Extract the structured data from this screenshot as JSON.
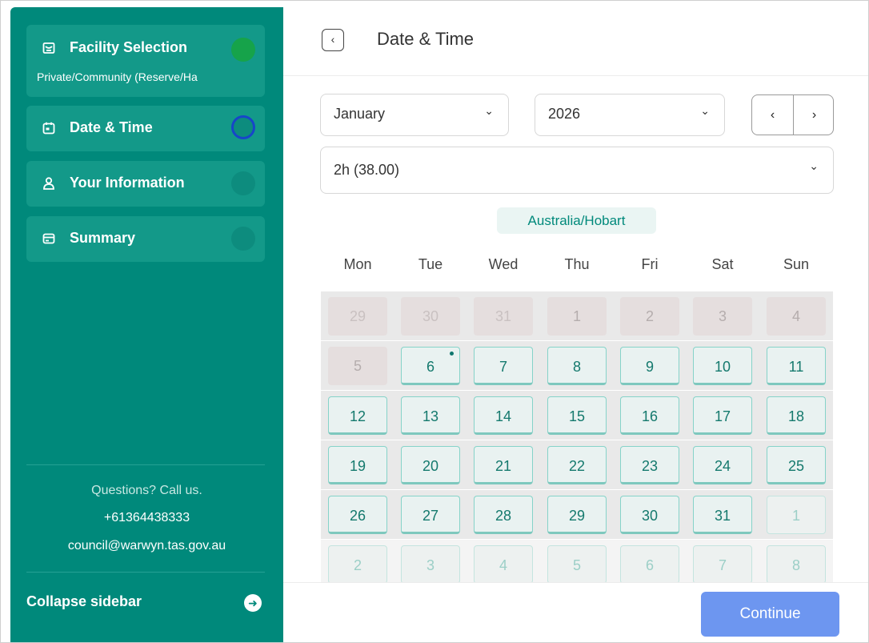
{
  "sidebar": {
    "steps": [
      {
        "label": "Facility Selection",
        "sub": "Private/Community (Reserve/Ha",
        "icon": "storefront-icon",
        "status": "complete"
      },
      {
        "label": "Date & Time",
        "icon": "calendar-icon",
        "status": "current"
      },
      {
        "label": "Your Information",
        "icon": "user-icon",
        "status": "pending"
      },
      {
        "label": "Summary",
        "icon": "card-icon",
        "status": "pending"
      }
    ],
    "contact": {
      "question": "Questions? Call us.",
      "phone": "+61364438333",
      "email": "council@warwyn.tas.gov.au"
    },
    "collapse_label": "Collapse sidebar"
  },
  "header": {
    "title": "Date & Time"
  },
  "filters": {
    "month": "January",
    "year": "2026",
    "duration": "2h (38.00)"
  },
  "timezone": "Australia/Hobart",
  "calendar": {
    "weekdays": [
      "Mon",
      "Tue",
      "Wed",
      "Thu",
      "Fri",
      "Sat",
      "Sun"
    ],
    "weeks": [
      [
        "29",
        "30",
        "31",
        "1",
        "2",
        "3",
        "4"
      ],
      [
        "5",
        "6",
        "7",
        "8",
        "9",
        "10",
        "11"
      ],
      [
        "12",
        "13",
        "14",
        "15",
        "16",
        "17",
        "18"
      ],
      [
        "19",
        "20",
        "21",
        "22",
        "23",
        "24",
        "25"
      ],
      [
        "26",
        "27",
        "28",
        "29",
        "30",
        "31",
        "1"
      ],
      [
        "2",
        "3",
        "4",
        "5",
        "6",
        "7",
        "8"
      ]
    ]
  },
  "footer": {
    "continue_label": "Continue"
  },
  "colors": {
    "sidebar": "#00897b",
    "accent": "#00897b",
    "complete": "#16a34a",
    "current_ring": "#1746c9",
    "primary_button": "#6d96f0"
  }
}
